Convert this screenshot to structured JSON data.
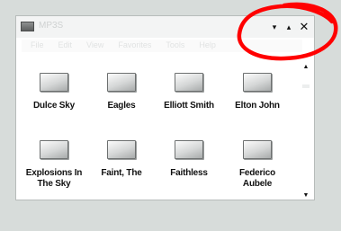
{
  "window": {
    "title": "MP3S",
    "app_icon": "drive-icon",
    "controls": {
      "minimize": "▾",
      "maximize": "▴",
      "close": "✕"
    }
  },
  "menubar": {
    "items": [
      "File",
      "Edit",
      "View",
      "Favorites",
      "Tools",
      "Help"
    ]
  },
  "folders": [
    {
      "label": "Dulce Sky"
    },
    {
      "label": "Eagles"
    },
    {
      "label": "Elliott Smith"
    },
    {
      "label": "Elton John"
    },
    {
      "label": "Explosions In\nThe Sky"
    },
    {
      "label": "Faint, The"
    },
    {
      "label": "Faithless"
    },
    {
      "label": "Federico Aubele"
    }
  ],
  "scrollbar": {
    "up": "▲",
    "down": "▼"
  },
  "annotation": {
    "color": "#ff0000",
    "shape": "freehand-circle-around-window-controls"
  },
  "colors": {
    "background": "#d7dcda",
    "window": "#ffffff"
  }
}
